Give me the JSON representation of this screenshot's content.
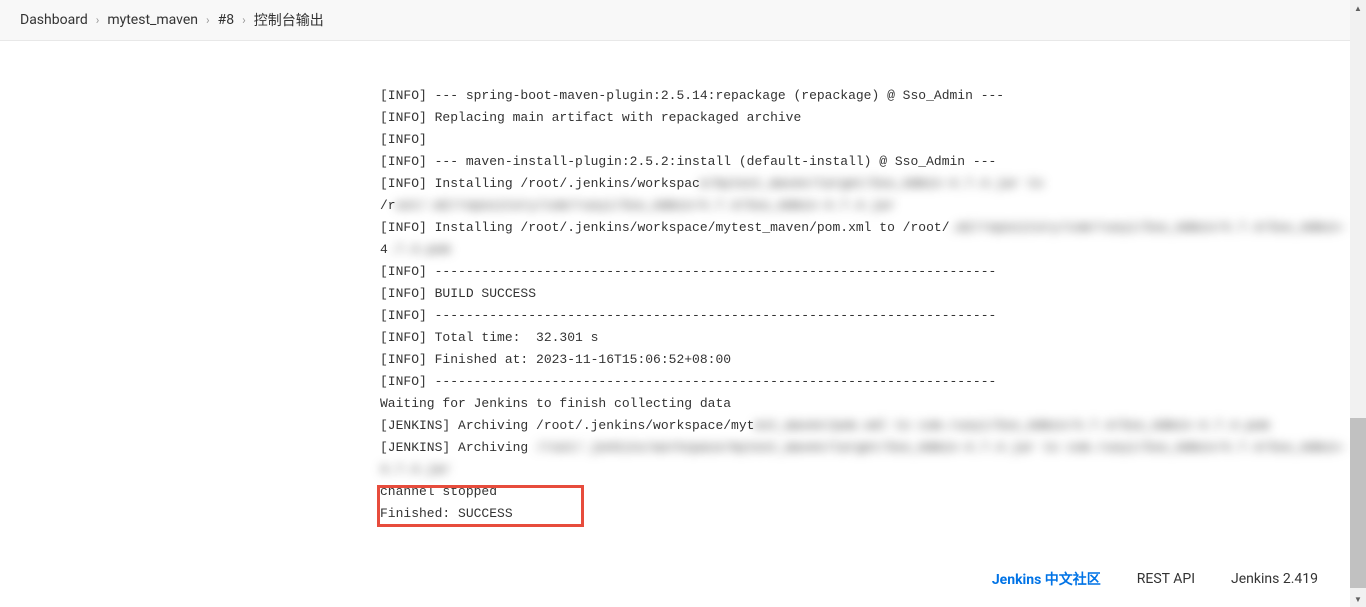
{
  "breadcrumb": {
    "items": [
      {
        "label": "Dashboard"
      },
      {
        "label": "mytest_maven"
      },
      {
        "label": "#8"
      },
      {
        "label": "控制台输出"
      }
    ]
  },
  "console": {
    "lines": [
      {
        "text": "[INFO] --- spring-boot-maven-plugin:2.5.14:repackage (repackage) @ Sso_Admin ---",
        "blurred": false,
        "cutoff": true
      },
      {
        "text": "[INFO] Replacing main artifact with repackaged archive",
        "blurred": false
      },
      {
        "text": "[INFO] ",
        "blurred": false
      },
      {
        "text": "[INFO] --- maven-install-plugin:2.5.2:install (default-install) @ Sso_Admin ---",
        "blurred": false
      },
      {
        "text": "[INFO] Installing /root/.jenkins/workspac",
        "blurred": false,
        "suffix_blurred": "e/mytest_maven/target/Sso_Admin-4.7.4.jar to"
      },
      {
        "text": "/r",
        "blurred": false,
        "suffix_blurred": "oot/.m2/repository/com/ruoyi/Sso_Admin/4.7.4/Sso_Admin-4.7.4.jar"
      },
      {
        "text": "[INFO] Installing /root/.jenkins/workspace/mytest_maven/pom.xml to /root/",
        "blurred": false,
        "suffix_blurred": ".m2/repository/com/ruoyi/Sso_Admin/4.7.4/Sso_Admin-"
      },
      {
        "text": "4",
        "blurred": false,
        "suffix_blurred": ".7.4.pom"
      },
      {
        "text": "[INFO] ------------------------------------------------------------------------",
        "blurred": false
      },
      {
        "text": "[INFO] BUILD SUCCESS",
        "blurred": false
      },
      {
        "text": "[INFO] ------------------------------------------------------------------------",
        "blurred": false
      },
      {
        "text": "[INFO] Total time:  32.301 s",
        "blurred": false
      },
      {
        "text": "[INFO] Finished at: 2023-11-16T15:06:52+08:00",
        "blurred": false
      },
      {
        "text": "[INFO] ------------------------------------------------------------------------",
        "blurred": false
      },
      {
        "text": "Waiting for Jenkins to finish collecting data",
        "blurred": false
      },
      {
        "text": "[JENKINS] Archiving /root/.jenkins/workspace/myt",
        "blurred": false,
        "suffix_blurred": "est_maven/pom.xml to com.ruoyi/Sso_Admin/4.7.4/Sso_Admin-4.7.4.pom"
      },
      {
        "text": "[JENKINS] Archiving ",
        "blurred": false,
        "suffix_blurred": "/root/.jenkins/workspace/mytest_maven/target/Sso_Admin-4.7.4.jar to com.ruoyi/Sso_Admin/4.7.4/Sso_Admin-"
      },
      {
        "text": "",
        "blurred": false,
        "suffix_blurred": "4.7.4.jar"
      },
      {
        "text": "channel stopped",
        "blurred": false
      },
      {
        "text": "Finished: SUCCESS",
        "blurred": false
      }
    ]
  },
  "footer": {
    "community_link": "Jenkins 中文社区",
    "rest_api": "REST API",
    "version": "Jenkins 2.419"
  }
}
